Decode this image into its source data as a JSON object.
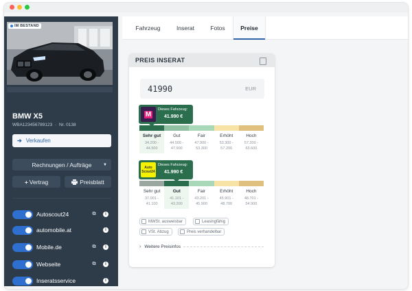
{
  "window": {
    "dots": [
      "#ff5f57",
      "#febc2e",
      "#28c840"
    ]
  },
  "sidebar": {
    "badge": "IM BESTAND",
    "car_name": "BMW X5",
    "vin": "WBA123456789123",
    "nr": "Nr. 0138",
    "sell_label": "Verkaufen",
    "invoices_label": "Rechnungen / Aufträge",
    "contract_label": "Vertrag",
    "priceflyer_label": "Preisblatt",
    "channels": [
      {
        "label": "Autoscout24",
        "enabled": true,
        "external": true
      },
      {
        "label": "automobile.at",
        "enabled": true,
        "external": false
      },
      {
        "label": "Mobile.de",
        "enabled": true,
        "external": true
      },
      {
        "label": "Webseite",
        "enabled": true,
        "external": true
      },
      {
        "label": "Inseratsservice",
        "enabled": true,
        "external": false
      }
    ]
  },
  "tabs": [
    {
      "label": "Fahrzeug",
      "active": false
    },
    {
      "label": "Inserat",
      "active": false
    },
    {
      "label": "Fotos",
      "active": false
    },
    {
      "label": "Preise",
      "active": true
    }
  ],
  "price_card": {
    "title": "PREIS INSERAT",
    "price": "41990",
    "currency": "EUR",
    "rating_labels": [
      "Sehr gut",
      "Gut",
      "Fair",
      "Erhöht",
      "Hoch"
    ],
    "bar_colors": [
      "#2b6e4e",
      "#92c0a2",
      "#a8d8b8",
      "#f7e3a6",
      "#e0c07e"
    ],
    "platforms": [
      {
        "logo_text": "M",
        "logo_bg": "#3a1d4e",
        "logo_accent": "#e2227a",
        "tooltip_title": "Dieses Fahrzeug:",
        "tooltip_value": "41.990 €",
        "position_index": 0,
        "ranges": [
          [
            "34.200 -",
            "44.500"
          ],
          [
            "44.500 -",
            "47.900"
          ],
          [
            "47.900 -",
            "53.300"
          ],
          [
            "53.300 -",
            "57.200"
          ],
          [
            "57.200 -",
            "63.600"
          ]
        ]
      },
      {
        "logo_text": "Auto Scout24",
        "logo_bg": "#f5f200",
        "logo_accent": "#333333",
        "tooltip_title": "Dieses Fahrzeug:",
        "tooltip_value": "41.990 €",
        "position_index": 1,
        "ranges": [
          [
            "37.001 -",
            "41.100"
          ],
          [
            "41.101 -",
            "43.200"
          ],
          [
            "43.201 -",
            "45.900"
          ],
          [
            "45.901 -",
            "48.700"
          ],
          [
            "48.701 -",
            "54.900"
          ]
        ]
      }
    ],
    "options": [
      "MWSt. ausweisbar",
      "Leasingfähig",
      "VSt. Abzug",
      "Preis verhandelbar"
    ],
    "more_label": "Weitere Preisinfos"
  }
}
